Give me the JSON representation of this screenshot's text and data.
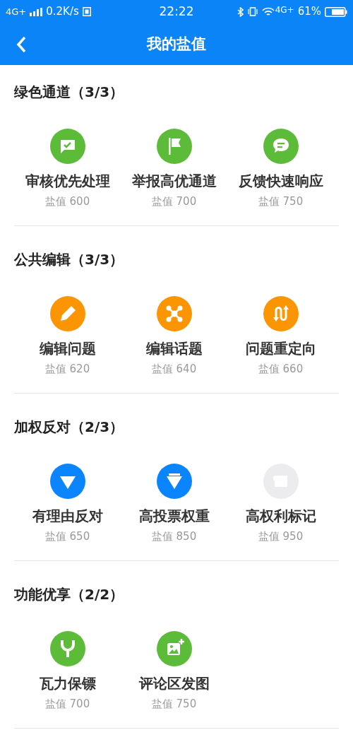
{
  "status_bar": {
    "network": "4G+",
    "speed": "0.2K/s",
    "time": "22:22",
    "network_2": "4G+",
    "battery": "61%"
  },
  "header": {
    "title": "我的盐值"
  },
  "sections": [
    {
      "title": "绿色通道（3/3）",
      "items": [
        {
          "kind": "check-bubble",
          "label": "审核优先处理",
          "value": "盐值 600",
          "color": "#5dbb3a"
        },
        {
          "kind": "flag",
          "label": "举报高优通道",
          "value": "盐值 700",
          "color": "#5dbb3a"
        },
        {
          "kind": "chat",
          "label": "反馈快速响应",
          "value": "盐值 750",
          "color": "#5dbb3a"
        }
      ]
    },
    {
      "title": "公共编辑（3/3）",
      "items": [
        {
          "kind": "pencil",
          "label": "编辑问题",
          "value": "盐值 620",
          "color": "#fb9504"
        },
        {
          "kind": "nodes",
          "label": "编辑话题",
          "value": "盐值 640",
          "color": "#fb9504"
        },
        {
          "kind": "redirect",
          "label": "问题重定向",
          "value": "盐值 660",
          "color": "#fb9504"
        }
      ]
    },
    {
      "title": "加权反对（2/3）",
      "items": [
        {
          "kind": "triangle",
          "label": "有理由反对",
          "value": "盐值 650",
          "color": "#0a84ff"
        },
        {
          "kind": "heavy-triangle",
          "label": "高投票权重",
          "value": "盐值 850",
          "color": "#0a84ff"
        },
        {
          "kind": "mark",
          "label": "高权利标记",
          "value": "盐值 950",
          "color": "#ecebee"
        }
      ]
    },
    {
      "title": "功能优享（2/2）",
      "items": [
        {
          "kind": "slingshot",
          "label": "瓦力保镖",
          "value": "盐值 700",
          "color": "#5dbb3a"
        },
        {
          "kind": "image-add",
          "label": "评论区发图",
          "value": "盐值 750",
          "color": "#5dbb3a"
        }
      ]
    }
  ]
}
